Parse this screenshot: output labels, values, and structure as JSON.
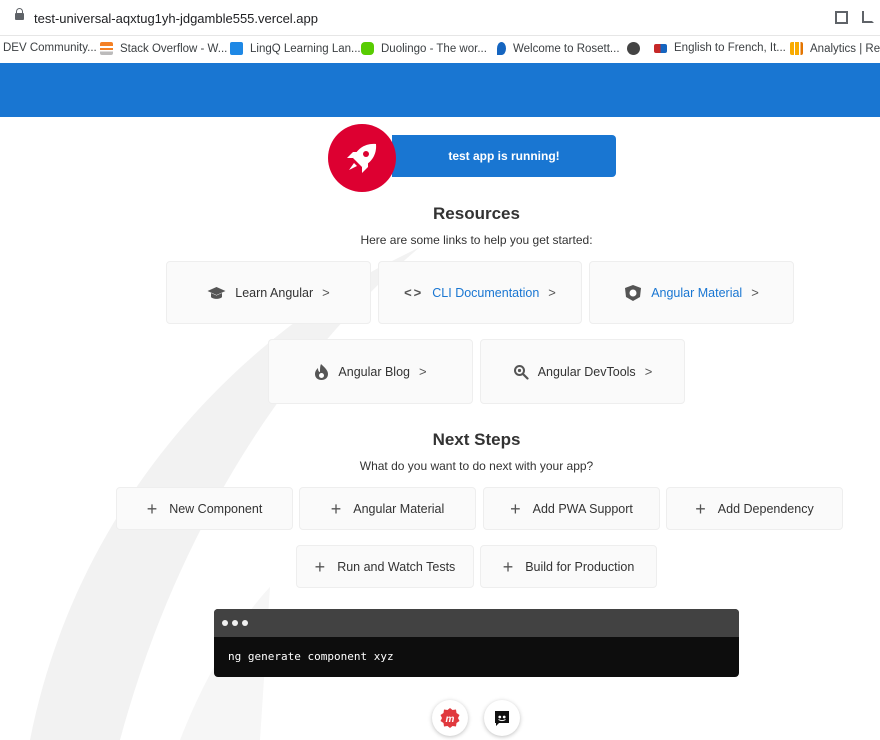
{
  "browser": {
    "url": "test-universal-aqxtug1yh-jdgamble555.vercel.app",
    "bookmarks": [
      {
        "label": "DEV Community...",
        "icon": "dev-icon",
        "color": "#000000"
      },
      {
        "label": "Stack Overflow - W...",
        "icon": "stackoverflow-icon",
        "color": "#f48024"
      },
      {
        "label": "LingQ Learning Lan...",
        "icon": "lingq-icon",
        "color": "#1e88e5"
      },
      {
        "label": "Duolingo - The wor...",
        "icon": "duolingo-icon",
        "color": "#58cc02"
      },
      {
        "label": "Welcome to Rosett...",
        "icon": "rosetta-icon",
        "color": "#1565c0"
      },
      {
        "label": "",
        "icon": "globe-icon",
        "color": "#444444"
      },
      {
        "label": "English to French, It...",
        "icon": "wordreference-icon",
        "color": "#c62828"
      },
      {
        "label": "Analytics | Repo",
        "icon": "analytics-icon",
        "color": "#f9ab00"
      }
    ]
  },
  "colors": {
    "toolbar": "#1976d2",
    "accent_red": "#dd0031",
    "link_blue": "#1976d2"
  },
  "header": {
    "running": "test app is running!"
  },
  "resources": {
    "title": "Resources",
    "subtitle": "Here are some links to help you get started:",
    "links": [
      {
        "label": "Learn Angular",
        "icon": "graduation-cap-icon"
      },
      {
        "label": "CLI Documentation",
        "icon": "code-icon"
      },
      {
        "label": "Angular Material",
        "icon": "material-shield-icon"
      },
      {
        "label": "Angular Blog",
        "icon": "flame-icon"
      },
      {
        "label": "Angular DevTools",
        "icon": "devtools-search-icon"
      }
    ],
    "arrow": ">"
  },
  "next_steps": {
    "title": "Next Steps",
    "subtitle": "What do you want to do next with your app?",
    "plus": "+",
    "items": [
      "New Component",
      "Angular Material",
      "Add PWA Support",
      "Add Dependency",
      "Run and Watch Tests",
      "Build for Production"
    ]
  },
  "terminal": {
    "command": "ng generate component xyz"
  },
  "social": [
    {
      "icon": "meetup-icon"
    },
    {
      "icon": "discord-icon"
    }
  ]
}
